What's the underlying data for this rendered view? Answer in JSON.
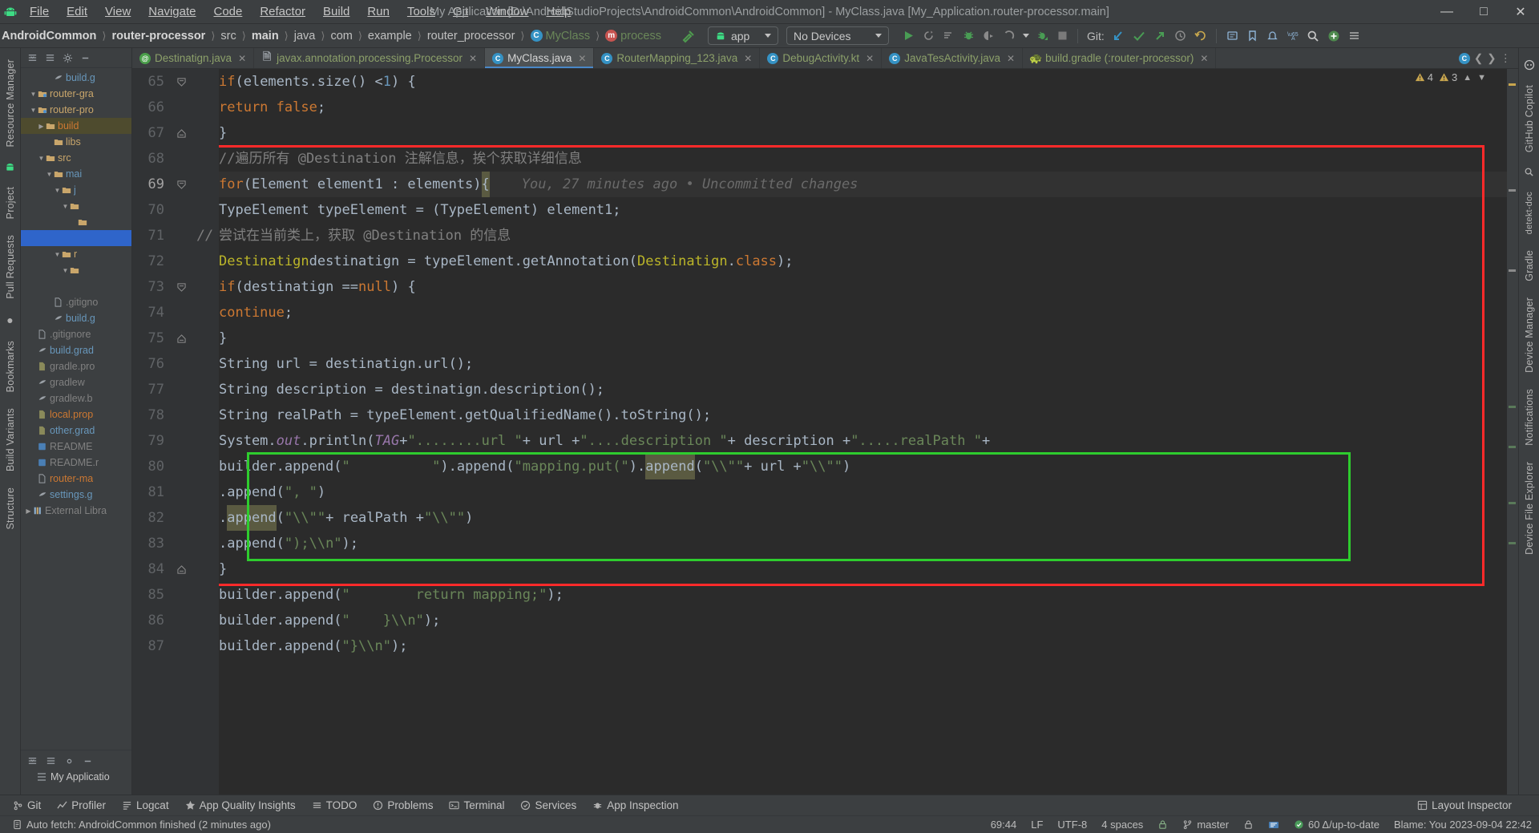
{
  "window": {
    "title": "My Application [D:\\AndroidStudioProjects\\AndroidCommon\\AndroidCommon] - MyClass.java [My_Application.router-processor.main]",
    "minimize": "—",
    "maximize": "☐",
    "close": "✕",
    "logo": "android-logo"
  },
  "menu": [
    {
      "label": "File"
    },
    {
      "label": "Edit"
    },
    {
      "label": "View"
    },
    {
      "label": "Navigate"
    },
    {
      "label": "Code"
    },
    {
      "label": "Refactor"
    },
    {
      "label": "Build"
    },
    {
      "label": "Run"
    },
    {
      "label": "Tools"
    },
    {
      "label": "Git"
    },
    {
      "label": "Window"
    },
    {
      "label": "Help"
    }
  ],
  "breadcrumbs": [
    {
      "label": "AndroidCommon",
      "style": "bold"
    },
    {
      "label": "router-processor",
      "style": "bold"
    },
    {
      "label": "src",
      "style": "normal"
    },
    {
      "label": "main",
      "style": "bold"
    },
    {
      "label": "java",
      "style": "normal"
    },
    {
      "label": "com",
      "style": "normal"
    },
    {
      "label": "example",
      "style": "normal"
    },
    {
      "label": "router_processor",
      "style": "normal"
    },
    {
      "label": "MyClass",
      "style": "green",
      "icon": "class-icon"
    },
    {
      "label": "process",
      "style": "green",
      "icon": "method-icon"
    }
  ],
  "toolbar": {
    "module_selector": "app",
    "device_selector": "No Devices",
    "git_label": "Git:",
    "icons": [
      "run-icon",
      "rerun-icon",
      "run-with-coverage-icon",
      "debug-icon",
      "profile-icon",
      "attach-icon",
      "dropdown-icon",
      "debug-attach-icon",
      "stop-icon",
      "git-update-icon",
      "git-commit-icon",
      "git-push-icon",
      "history-icon",
      "undo-icon",
      "search-everywhere-icon",
      "bookmarks-icon",
      "notifications-icon",
      "translate-icon",
      "search-icon",
      "plugins-icon",
      "menu-icon"
    ]
  },
  "sidebar_left": [
    "Resource Manager",
    "Project",
    "Pull Requests",
    "Bookmarks",
    "Build Variants",
    "Structure"
  ],
  "sidebar_right": [
    "GitHub Copilot",
    "Device Manager",
    "Gradle",
    "Notifications",
    "Device File Explorer"
  ],
  "project_tree": [
    {
      "indent": 3,
      "arrow": "",
      "icon": "gradle-file-icon",
      "label": "build.g",
      "color": "clr-b"
    },
    {
      "indent": 1,
      "arrow": "▼",
      "icon": "module-icon",
      "label": "router-gra",
      "color": "clr-y"
    },
    {
      "indent": 1,
      "arrow": "▼",
      "icon": "module-icon",
      "label": "router-pro",
      "color": "clr-y"
    },
    {
      "indent": 2,
      "arrow": "▶",
      "icon": "folder-icon",
      "label": "build",
      "color": "clr-or",
      "highlight": true
    },
    {
      "indent": 3,
      "arrow": "",
      "icon": "folder-icon",
      "label": "libs",
      "color": "clr-y"
    },
    {
      "indent": 2,
      "arrow": "▼",
      "icon": "folder-icon",
      "label": "src",
      "color": "clr-y"
    },
    {
      "indent": 3,
      "arrow": "▼",
      "icon": "folder-icon",
      "label": "mai",
      "color": "clr-b"
    },
    {
      "indent": 4,
      "arrow": "▼",
      "icon": "folder-icon",
      "label": "j",
      "color": "clr-b"
    },
    {
      "indent": 5,
      "arrow": "▼",
      "icon": "folder-icon",
      "label": "",
      "color": "clr-y"
    },
    {
      "indent": 6,
      "arrow": "",
      "icon": "folder-icon",
      "label": "",
      "color": "clr-y"
    },
    {
      "indent": 6,
      "arrow": "",
      "icon": "",
      "label": "",
      "color": "clr-y",
      "selected": true
    },
    {
      "indent": 4,
      "arrow": "▼",
      "icon": "folder-icon",
      "label": "r",
      "color": "clr-y"
    },
    {
      "indent": 5,
      "arrow": "▼",
      "icon": "folder-icon",
      "label": "",
      "color": "clr-y"
    },
    {
      "indent": 5,
      "arrow": "",
      "icon": "",
      "label": "",
      "color": "clr-y"
    },
    {
      "indent": 3,
      "arrow": "",
      "icon": "file-icon",
      "label": ".gitigno",
      "color": "clr-gr"
    },
    {
      "indent": 3,
      "arrow": "",
      "icon": "gradle-file-icon",
      "label": "build.g",
      "color": "clr-b"
    },
    {
      "indent": 1,
      "arrow": "",
      "icon": "file-icon",
      "label": ".gitignore",
      "color": "clr-gr"
    },
    {
      "indent": 1,
      "arrow": "",
      "icon": "gradle-file-icon",
      "label": "build.grad",
      "color": "clr-b"
    },
    {
      "indent": 1,
      "arrow": "",
      "icon": "properties-icon",
      "label": "gradle.pro",
      "color": "clr-gr"
    },
    {
      "indent": 1,
      "arrow": "",
      "icon": "gradle-file-icon",
      "label": "gradlew",
      "color": "clr-gr"
    },
    {
      "indent": 1,
      "arrow": "",
      "icon": "gradle-file-icon",
      "label": "gradlew.b",
      "color": "clr-gr"
    },
    {
      "indent": 1,
      "arrow": "",
      "icon": "properties-icon",
      "label": "local.prop",
      "color": "clr-or"
    },
    {
      "indent": 1,
      "arrow": "",
      "icon": "properties-icon",
      "label": "other.grad",
      "color": "clr-b"
    },
    {
      "indent": 1,
      "arrow": "",
      "icon": "md-icon",
      "label": "README",
      "color": "clr-gr"
    },
    {
      "indent": 1,
      "arrow": "",
      "icon": "md-icon",
      "label": "README.r",
      "color": "clr-gr"
    },
    {
      "indent": 1,
      "arrow": "",
      "icon": "file-icon",
      "label": "router-ma",
      "color": "clr-or"
    },
    {
      "indent": 1,
      "arrow": "",
      "icon": "gradle-file-icon",
      "label": "settings.g",
      "color": "clr-b"
    },
    {
      "indent": 0,
      "arrow": "▶",
      "icon": "library-icon",
      "label": "External Libra",
      "color": "clr-gr"
    }
  ],
  "project_footer": {
    "label": "My Applicatio"
  },
  "tabs": [
    {
      "label": "Destinatign.java",
      "icon": "annotation-icon",
      "active": false
    },
    {
      "label": "javax.annotation.processing.Processor",
      "icon": "readonly-file-icon",
      "active": false
    },
    {
      "label": "MyClass.java",
      "icon": "class-icon",
      "active": true
    },
    {
      "label": "RouterMapping_123.java",
      "icon": "class-icon",
      "active": false
    },
    {
      "label": "DebugActivity.kt",
      "icon": "kotlin-class-icon",
      "active": false
    },
    {
      "label": "JavaTesActivity.java",
      "icon": "class-icon",
      "active": false
    },
    {
      "label": "build.gradle (:router-processor)",
      "icon": "gradle-file-icon",
      "active": false
    }
  ],
  "inspection": {
    "warnings": "4",
    "weak_warnings": "3",
    "warn_icon": "warning-triangle-icon",
    "collapse_icon": "chevron-up-icon"
  },
  "code": {
    "first_line": 65,
    "blame": "You, 27 minutes ago • Uncommitted changes",
    "lines": [
      {
        "n": 65,
        "fold": "collapse",
        "html": "    <span class='kw'>if</span> <span class='stat'>(elements.size() &lt;</span> <span class='num'>1</span><span class='stat'>) {</span>"
      },
      {
        "n": 66,
        "fold": "",
        "html": "        <span class='kw'>return false</span><span class='stat'>;</span>"
      },
      {
        "n": 67,
        "fold": "collapse2",
        "html": "    <span class='stat'>}</span>"
      },
      {
        "n": 68,
        "fold": "",
        "html": "    <span class='cmt'>//遍历所有 @Destination 注解信息，挨个获取详细信息</span>"
      },
      {
        "n": 69,
        "fold": "collapse",
        "html": "    <span class='kw'>for</span> <span class='stat'>(Element element1 : elements)</span> <span class='hl-word stat'>{</span>"
      },
      {
        "n": 70,
        "fold": "",
        "html": "        <span class='stat'>TypeElement typeElement = (TypeElement) element1;</span>"
      },
      {
        "n": 71,
        "fold": "",
        "annotation": "//",
        "html": "          <span class='cmt'>尝试在当前类上，获取 @Destination 的信息</span>"
      },
      {
        "n": 72,
        "fold": "",
        "html": "        <span class='ann'>Destinatign</span> <span class='stat'>destinatign = typeElement.getAnnotation(</span><span class='ann'>Destinatign</span><span class='stat'>.</span><span class='kw'>class</span><span class='stat'>);</span>"
      },
      {
        "n": 73,
        "fold": "collapse",
        "html": "        <span class='kw'>if</span> <span class='stat'>(destinatign ==</span> <span class='kw'>null</span><span class='stat'>) {</span>"
      },
      {
        "n": 74,
        "fold": "",
        "html": "            <span class='kw'>continue</span><span class='stat'>;</span>"
      },
      {
        "n": 75,
        "fold": "collapse2",
        "html": "        <span class='stat'>}</span>"
      },
      {
        "n": 76,
        "fold": "",
        "html": "        <span class='stat'>String url = destinatign.url();</span>"
      },
      {
        "n": 77,
        "fold": "",
        "html": "        <span class='stat'>String description = destinatign.description();</span>"
      },
      {
        "n": 78,
        "fold": "",
        "html": "        <span class='stat'>String realPath = typeElement.getQualifiedName().toString();</span>"
      },
      {
        "n": 79,
        "fold": "",
        "html": "        <span class='stat'>System.</span><span class='fld'>out</span><span class='stat'>.println(</span><span class='fld'>TAG</span> <span class='stat'>+</span> <span class='str'>\"........url \"</span> <span class='stat'>+ url +</span> <span class='str'>\"....description \"</span> <span class='stat'>+ description +</span> <span class='str'>\".....realPath \"</span> <span class='stat'>+</span>"
      },
      {
        "n": 80,
        "fold": "",
        "html": "        <span class='stat'>builder.append(</span><span class='str'>\"          \"</span><span class='stat'>).append(</span><span class='str'>\"mapping.put(\"</span><span class='stat'>).</span><span class='hl-word stat'>append</span><span class='stat'>(</span><span class='str'>\"\\\\\"\"</span> <span class='stat'>+ url +</span> <span class='str'>\"\\\\\"\"</span><span class='stat'>)</span>"
      },
      {
        "n": 81,
        "fold": "",
        "html": "                <span class='stat'>.append(</span><span class='str'>\", \"</span><span class='stat'>)</span>"
      },
      {
        "n": 82,
        "fold": "",
        "html": "                <span class='stat'>.</span><span class='hl-word stat'>append</span><span class='stat'>(</span><span class='str'>\"\\\\\"\"</span> <span class='stat'>+ realPath +</span> <span class='str'>\"\\\\\"\"</span><span class='stat'>)</span>"
      },
      {
        "n": 83,
        "fold": "",
        "html": "                <span class='stat'>.append(</span><span class='str'>\");\\\\n\"</span><span class='stat'>);</span>"
      },
      {
        "n": 84,
        "fold": "collapse2",
        "html": "    <span class='stat'>}</span>"
      },
      {
        "n": 85,
        "fold": "",
        "html": "    <span class='stat'>builder.append(</span><span class='str'>\"        return mapping;\"</span><span class='stat'>);</span>"
      },
      {
        "n": 86,
        "fold": "",
        "html": "    <span class='stat'>builder.append(</span><span class='str'>\"    }\\\\n\"</span><span class='stat'>);</span>"
      },
      {
        "n": 87,
        "fold": "",
        "html": "    <span class='stat'>builder.append(</span><span class='str'>\"}\\\\n\"</span><span class='stat'>);</span>"
      }
    ]
  },
  "annotations": {
    "red_box_label": "red-highlight-box",
    "green_box_label": "green-highlight-box",
    "red_color": "#ff2a2a",
    "green_color": "#2ecc2e"
  },
  "bottom_tools": [
    {
      "label": "Git",
      "icon": "git-icon"
    },
    {
      "label": "Profiler",
      "icon": "profiler-icon"
    },
    {
      "label": "Logcat",
      "icon": "logcat-icon"
    },
    {
      "label": "App Quality Insights",
      "icon": "insights-icon"
    },
    {
      "label": "TODO",
      "icon": "todo-icon"
    },
    {
      "label": "Problems",
      "icon": "problems-icon"
    },
    {
      "label": "Terminal",
      "icon": "terminal-icon"
    },
    {
      "label": "Services",
      "icon": "services-icon"
    },
    {
      "label": "App Inspection",
      "icon": "inspection-icon"
    }
  ],
  "bottom_tools_right": {
    "label": "Layout Inspector",
    "icon": "layout-inspector-icon"
  },
  "status": {
    "message": "Auto fetch: AndroidCommon finished (2 minutes ago)",
    "message_icon": "info-icon",
    "caret": "69:44",
    "line_sep": "LF",
    "encoding": "UTF-8",
    "indent": "4 spaces",
    "lock_icon": "lock-icon",
    "branch": "master",
    "branch_icon": "git-branch-icon",
    "gradle_icon": "gradle-icon",
    "memory": "60 Δ/up-to-date",
    "blame": "Blame: You 2023-09-04 22:42",
    "inspect_icon": "inspection-eye-icon"
  }
}
